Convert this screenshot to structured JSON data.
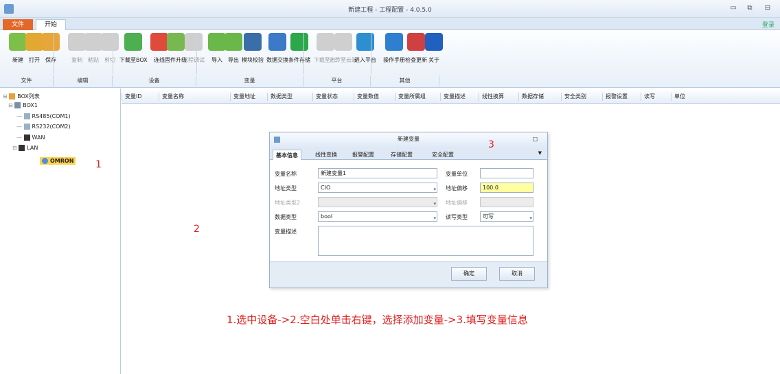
{
  "window": {
    "title": "新建工程 - 工程配置 - 4.0.5.0",
    "buttons": {
      "minimize": "▭",
      "restore": "⧉",
      "close": "⊟"
    }
  },
  "tabs": {
    "file": "文件",
    "home": "开始",
    "login": "登录"
  },
  "ribbon": {
    "buttons": [
      {
        "label": "新建",
        "icon": "new-icon",
        "color": "#7cc04a"
      },
      {
        "label": "打开",
        "icon": "open-folder-icon",
        "color": "#e3a832"
      },
      {
        "label": "保存",
        "icon": "save-icon",
        "color": "#e8a53a"
      },
      {
        "label": "复制",
        "icon": "copy-icon",
        "color": "#cfcfcf"
      },
      {
        "label": "粘贴",
        "icon": "paste-icon",
        "color": "#cfcfcf"
      },
      {
        "label": "剪切",
        "icon": "cut-icon",
        "color": "#cfcfcf"
      },
      {
        "label": "下载至BOX",
        "icon": "download-arrow-icon",
        "color": "#4caf50"
      },
      {
        "label": "连线",
        "icon": "connect-icon",
        "color": "#e04a3a"
      },
      {
        "label": "固件升级",
        "icon": "firmware-upgrade-icon",
        "color": "#78b850"
      },
      {
        "label": "远程调试",
        "icon": "remote-debug-icon",
        "color": "#cfcfcf"
      },
      {
        "label": "导入",
        "icon": "import-icon",
        "color": "#6ab84a"
      },
      {
        "label": "导出",
        "icon": "export-icon",
        "color": "#6ab84a"
      },
      {
        "label": "模块校验",
        "icon": "module-check-icon",
        "color": "#3a6ea8"
      },
      {
        "label": "数据交换",
        "icon": "data-exchange-icon",
        "color": "#3a7ac8"
      },
      {
        "label": "条件存储",
        "icon": "condition-storage-icon",
        "color": "#2aa84a"
      },
      {
        "label": "下载至PC",
        "icon": "download-pc-icon",
        "color": "#cfcfcf"
      },
      {
        "label": "上传至云端",
        "icon": "upload-cloud-icon",
        "color": "#cfcfcf"
      },
      {
        "label": "进入平台",
        "icon": "globe-icon",
        "color": "#2e8fd0"
      },
      {
        "label": "操作手册",
        "icon": "help-icon",
        "color": "#2e7fd0"
      },
      {
        "label": "检查更新",
        "icon": "update-check-icon",
        "color": "#d04040"
      },
      {
        "label": "关于",
        "icon": "info-icon",
        "color": "#2060c0"
      }
    ],
    "groups": [
      "文件",
      "编辑",
      "设备",
      "变量",
      "平台",
      "其他"
    ]
  },
  "tree": {
    "root": "BOX列表",
    "device": "BOX1",
    "rs485": "RS485(COM1)",
    "rs232": "RS232(COM2)",
    "wan": "WAN",
    "lan": "LAN",
    "plc": "OMRON"
  },
  "columns": [
    "变量ID",
    "变量名称",
    "变量地址",
    "数据类型",
    "变量状态",
    "变量数值",
    "变量所属组",
    "变量描述",
    "线性换算",
    "数据存储",
    "安全类别",
    "报警设置",
    "读写",
    "单位"
  ],
  "dialog": {
    "title": "新建变量",
    "close_btn": "□",
    "tabs": [
      "基本信息",
      "线性变换",
      "报警配置",
      "存储配置",
      "安全配置"
    ],
    "labels": {
      "name": "变量名称",
      "addr_type": "地址类型",
      "addr_type2": "地址类型2",
      "data_type": "数据类型",
      "desc": "变量描述",
      "unit": "变量单位",
      "offset": "地址偏移",
      "offset2": "地址偏移",
      "rw": "读写类型"
    },
    "values": {
      "name": "新建变量1",
      "addr_type": "CIO",
      "offset": "100.0",
      "data_type": "bool",
      "rw": "可写"
    },
    "buttons": {
      "ok": "确定",
      "cancel": "取消"
    }
  },
  "annotations": {
    "a1": "1",
    "a2": "2",
    "a3": "3"
  },
  "instruction": "1.选中设备->2.空白处单击右键，选择添加变量->3.填写变量信息"
}
